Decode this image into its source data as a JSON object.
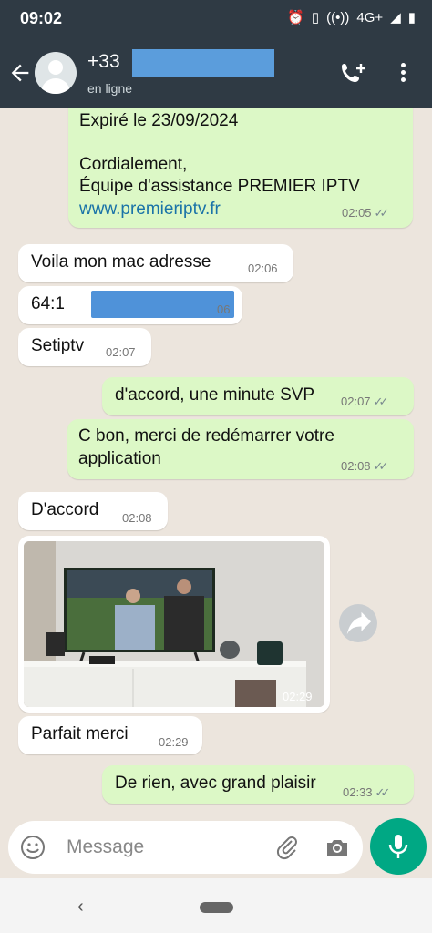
{
  "status_bar": {
    "time": "09:02",
    "network": "4G+"
  },
  "header": {
    "contact_number_visible": "+33",
    "status": "en ligne"
  },
  "messages": [
    {
      "dir": "out",
      "lines": [
        "Expiré le 23/09/2024",
        "",
        "Cordialement,",
        "Équipe d'assistance PREMIER IPTV",
        "www.premieriptv.fr"
      ],
      "time": "02:05"
    },
    {
      "dir": "in",
      "text": "Voila mon mac adresse",
      "time": "02:06"
    },
    {
      "dir": "in",
      "text_prefix": "64:1",
      "time_partial": "06"
    },
    {
      "dir": "in",
      "text": "Setiptv",
      "time": "02:07"
    },
    {
      "dir": "out",
      "text": "d'accord, une minute SVP",
      "time": "02:07"
    },
    {
      "dir": "out",
      "lines": [
        "C bon, merci de redémarrer votre",
        "application"
      ],
      "time": "02:08"
    },
    {
      "dir": "in",
      "text": "D'accord",
      "time": "02:08"
    },
    {
      "dir": "in",
      "type": "image",
      "time": "02:29"
    },
    {
      "dir": "in",
      "text": "Parfait merci",
      "time": "02:29"
    },
    {
      "dir": "out",
      "text": "De rien, avec grand plaisir",
      "time": "02:33"
    }
  ],
  "input": {
    "placeholder": "Message"
  },
  "colors": {
    "header": "#2f3a44",
    "outgoing": "#dcf8c6",
    "incoming": "#ffffff",
    "accent": "#00a884",
    "link": "#1a73a8"
  }
}
